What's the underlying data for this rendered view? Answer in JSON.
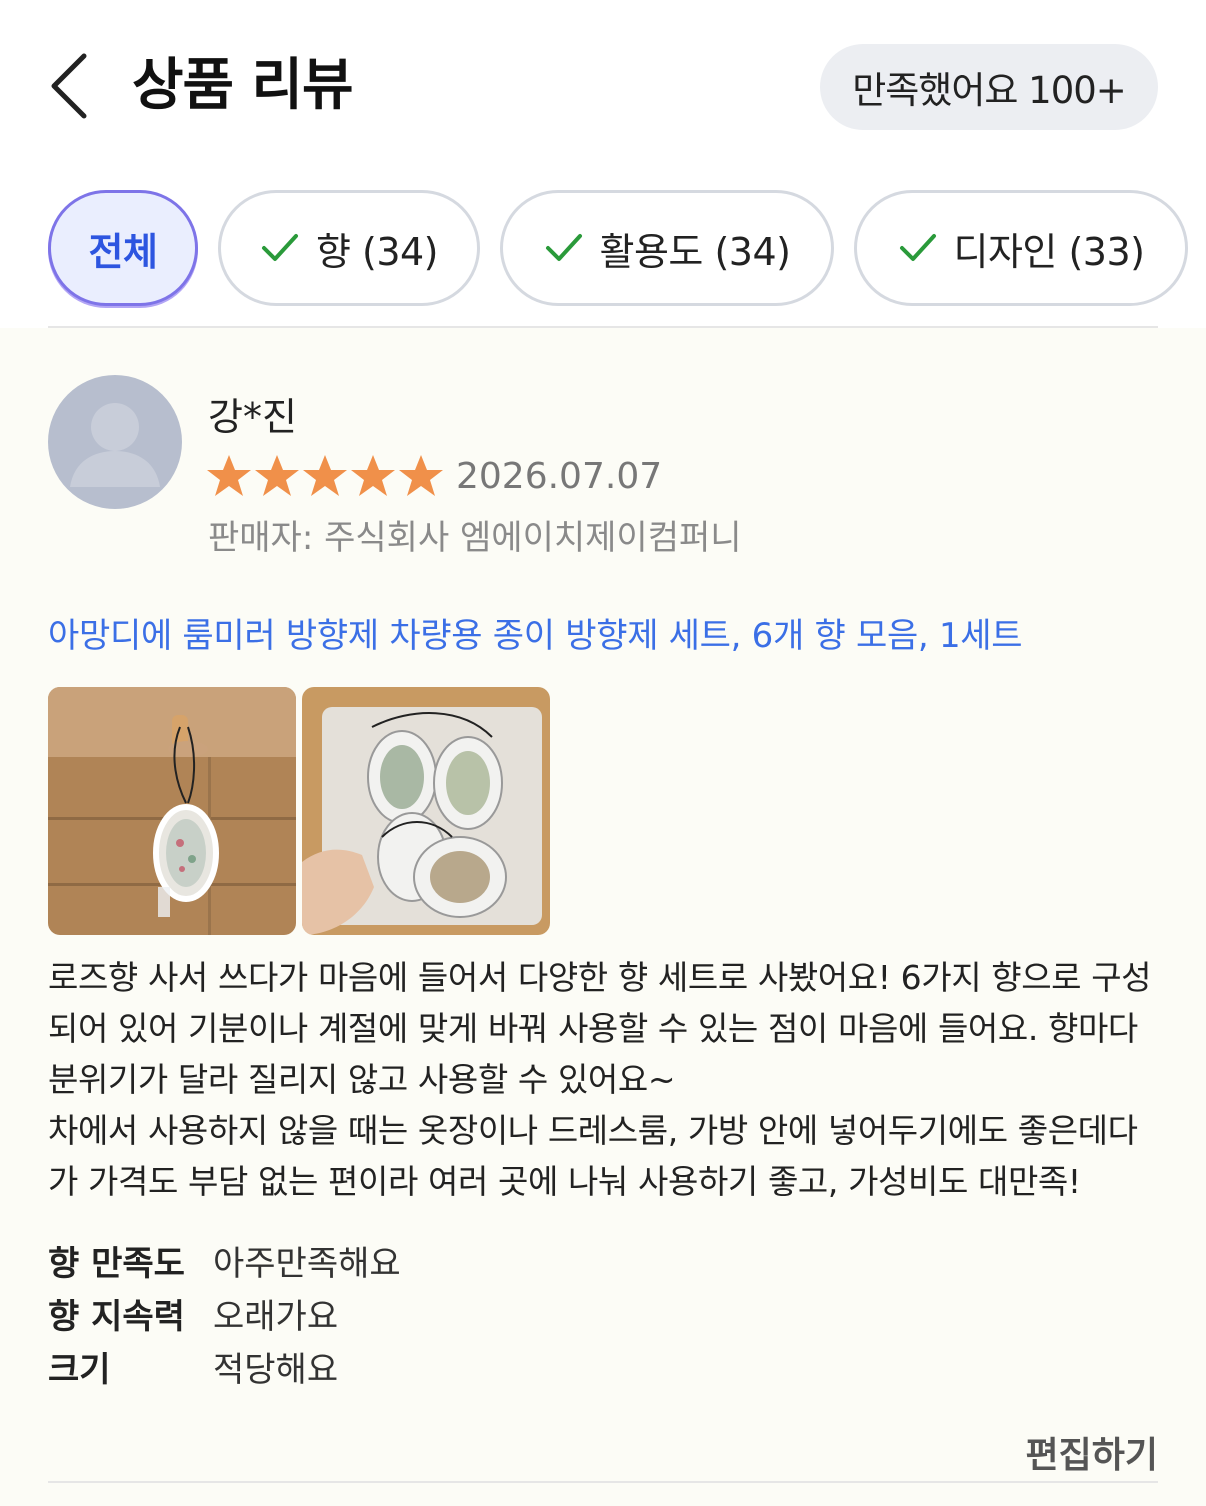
{
  "header": {
    "title": "상품 리뷰",
    "satisfied_label": "만족했어요 100+"
  },
  "filters": [
    {
      "label": "전체",
      "active": true
    },
    {
      "label": "향 (34)",
      "active": false
    },
    {
      "label": "활용도 (34)",
      "active": false
    },
    {
      "label": "디자인 (33)",
      "active": false
    }
  ],
  "review": {
    "reviewer": "강*진",
    "rating": 5,
    "date": "2026.07.07",
    "seller": "판매자: 주식회사 엠에이치제이컴퍼니",
    "product": "아망디에 룸미러 방향제 차량용 종이 방향제 세트, 6개 향 모음, 1세트",
    "text_paragraph_1": "로즈향 사서 쓰다가 마음에 들어서 다양한 향 세트로 사봤어요! 6가지 향으로 구성되어 있어 기분이나 계절에 맞게 바꿔 사용할 수 있는 점이 마음에 들어요. 향마다 분위기가 달라 질리지 않고 사용할 수 있어요~",
    "text_paragraph_2": "차에서 사용하지 않을 때는 옷장이나 드레스룸, 가방 안에 넣어두기에도 좋은데다가 가격도 부담 없는 편이라 여러 곳에 나눠 사용하기 좋고, 가성비도 대만족!",
    "attributes": [
      {
        "label": "향 만족도",
        "value": "아주만족해요"
      },
      {
        "label": "향 지속력",
        "value": "오래가요"
      },
      {
        "label": "크기",
        "value": "적당해요"
      }
    ],
    "edit_label": "편집하기"
  },
  "colors": {
    "accent_blue": "#3b6fe6",
    "star_orange": "#f0904a",
    "check_green": "#2a9a3a",
    "active_chip_border": "#7e74e8"
  }
}
